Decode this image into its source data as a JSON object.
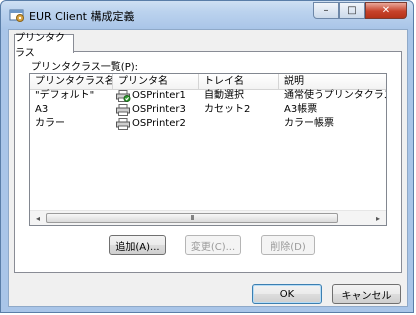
{
  "window": {
    "title": "EUR Client 構成定義",
    "minimize_glyph": "–",
    "maximize_glyph": "□",
    "close_glyph": "✕"
  },
  "tab": {
    "label": "プリンタクラス"
  },
  "list": {
    "label": "プリンタクラス一覧(P):",
    "columns": [
      "プリンタクラス名",
      "プリンタ名",
      "トレイ名",
      "説明"
    ],
    "rows": [
      {
        "class_name": "\"デフォルト\"",
        "printer": "OSPrinter1",
        "tray": "自動選択",
        "description": "通常使うプリンタクラス",
        "default_printer": true
      },
      {
        "class_name": "A3",
        "printer": "OSPrinter3",
        "tray": "カセット2",
        "description": "A3帳票",
        "default_printer": false
      },
      {
        "class_name": "カラー",
        "printer": "OSPrinter2",
        "tray": "",
        "description": "カラー帳票",
        "default_printer": false
      }
    ],
    "scroll_left_glyph": "◂",
    "scroll_right_glyph": "▸",
    "scroll_grip": "III"
  },
  "buttons": {
    "add": "追加(A)...",
    "change": "変更(C)...",
    "delete": "削除(D)",
    "ok": "OK",
    "cancel": "キャンセル"
  },
  "colors": {
    "titlebar": "#bcd3ee",
    "close_button": "#c7422b",
    "check_badge": "#2f9a2f"
  },
  "icons": {
    "app": "settings-window-icon",
    "printer": "printer-icon",
    "default_badge": "check-badge-icon"
  }
}
